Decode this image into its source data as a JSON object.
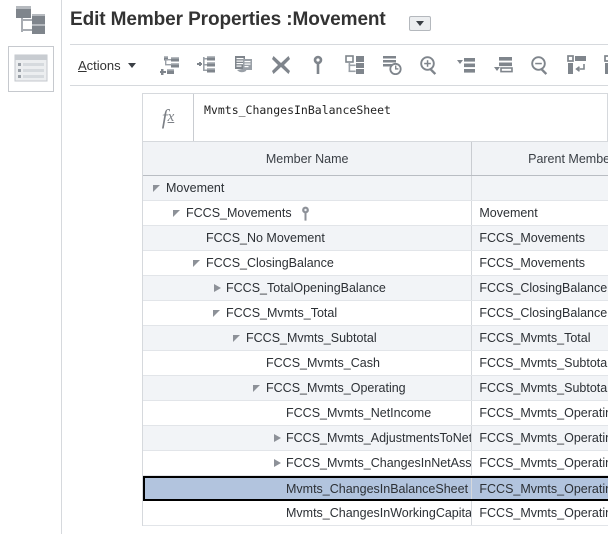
{
  "sidebar": {
    "items": [
      {
        "name": "hierarchy-icon",
        "label": "Dimensions",
        "selected": false
      },
      {
        "name": "grid-list-icon",
        "label": "Member Properties Grid",
        "selected": true
      }
    ]
  },
  "header": {
    "title": "Edit Member Properties :Movement",
    "dropdown_label": "chevron-down-icon"
  },
  "toolbar": {
    "actions_label": "Actions",
    "actions_accelerator": "A",
    "buttons": [
      {
        "icon": "add-child-icon",
        "label": "Add Child"
      },
      {
        "icon": "add-sibling-icon",
        "label": "Add Sibling"
      },
      {
        "icon": "copy-member-icon",
        "label": "Copy Member"
      },
      {
        "icon": "delete-icon",
        "label": "Delete"
      },
      {
        "icon": "key-icon",
        "label": "Set as Primary"
      },
      {
        "icon": "expand-hierarchy-icon",
        "label": "Expand Hierarchy"
      },
      {
        "icon": "history-list-icon",
        "label": "Show History"
      },
      {
        "icon": "zoom-in-icon",
        "label": "Zoom In"
      },
      {
        "icon": "indent-less-icon",
        "label": "Move Left"
      },
      {
        "icon": "indent-more-icon",
        "label": "Move Right"
      },
      {
        "icon": "zoom-out-icon",
        "label": "Zoom Out"
      },
      {
        "icon": "insert-row-icon",
        "label": "Insert Row"
      },
      {
        "icon": "delete-row-icon",
        "label": "Delete Row"
      }
    ]
  },
  "formula_bar": {
    "fx_label": "fx",
    "value": "Mvmts_ChangesInBalanceSheet"
  },
  "grid": {
    "columns": [
      {
        "key": "member_name",
        "label": "Member Name"
      },
      {
        "key": "parent_member",
        "label": "Parent Member"
      }
    ],
    "rows": [
      {
        "member_name": "Movement",
        "parent_member": "",
        "indent": 0,
        "twisty": "expanded",
        "badge": "",
        "selected": false
      },
      {
        "member_name": "FCCS_Movements",
        "parent_member": "Movement",
        "indent": 1,
        "twisty": "expanded",
        "badge": "key-icon",
        "selected": false
      },
      {
        "member_name": "FCCS_No Movement",
        "parent_member": "FCCS_Movements",
        "indent": 2,
        "twisty": "none",
        "badge": "",
        "selected": false
      },
      {
        "member_name": "FCCS_ClosingBalance",
        "parent_member": "FCCS_Movements",
        "indent": 2,
        "twisty": "expanded",
        "badge": "",
        "selected": false
      },
      {
        "member_name": "FCCS_TotalOpeningBalance",
        "parent_member": "FCCS_ClosingBalance",
        "indent": 3,
        "twisty": "collapsed",
        "badge": "",
        "selected": false
      },
      {
        "member_name": "FCCS_Mvmts_Total",
        "parent_member": "FCCS_ClosingBalance",
        "indent": 3,
        "twisty": "expanded",
        "badge": "",
        "selected": false
      },
      {
        "member_name": "FCCS_Mvmts_Subtotal",
        "parent_member": "FCCS_Mvmts_Total",
        "indent": 4,
        "twisty": "expanded",
        "badge": "",
        "selected": false
      },
      {
        "member_name": "FCCS_Mvmts_Cash",
        "parent_member": "FCCS_Mvmts_Subtotal",
        "indent": 5,
        "twisty": "none",
        "badge": "",
        "selected": false
      },
      {
        "member_name": "FCCS_Mvmts_Operating",
        "parent_member": "FCCS_Mvmts_Subtotal",
        "indent": 5,
        "twisty": "expanded",
        "badge": "",
        "selected": false
      },
      {
        "member_name": "FCCS_Mvmts_NetIncome",
        "parent_member": "FCCS_Mvmts_Operating",
        "indent": 6,
        "twisty": "none",
        "badge": "",
        "selected": false
      },
      {
        "member_name": "FCCS_Mvmts_AdjustmentsToNetIncome",
        "parent_member": "FCCS_Mvmts_Operating",
        "indent": 6,
        "twisty": "collapsed",
        "badge": "",
        "selected": false
      },
      {
        "member_name": "FCCS_Mvmts_ChangesInNetAssets",
        "parent_member": "FCCS_Mvmts_Operating",
        "indent": 6,
        "twisty": "collapsed",
        "badge": "",
        "selected": false
      },
      {
        "member_name": "Mvmts_ChangesInBalanceSheet",
        "parent_member": "FCCS_Mvmts_Operating",
        "indent": 6,
        "twisty": "none",
        "badge": "",
        "selected": true
      },
      {
        "member_name": "Mvmts_ChangesInWorkingCapital",
        "parent_member": "FCCS_Mvmts_Operating",
        "indent": 6,
        "twisty": "none",
        "badge": "",
        "selected": false
      }
    ]
  },
  "colors": {
    "selection_fill": "#b2c4de",
    "selection_border": "#000000",
    "header_fill": "#f1f3f6",
    "row_alt_fill": "#f2f4f7",
    "icon_gray": "#7f858c",
    "border": "#d6d9dd"
  }
}
